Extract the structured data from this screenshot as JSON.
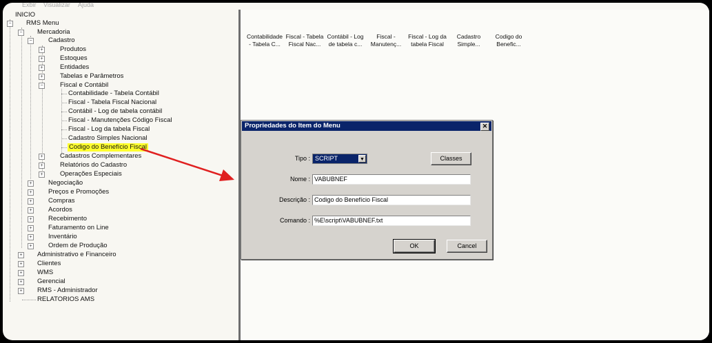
{
  "menubar": {
    "items": [
      "Exbir",
      "Visualizar",
      "Ajuda"
    ]
  },
  "tree": {
    "root": "INICIO",
    "rms_menu": "RMS Menu",
    "mercadorias": "Mercadoria",
    "cadastro": "Cadastro",
    "cadastro_children": [
      "Produtos",
      "Estoques",
      "Entidades",
      "Tabelas e Parâmetros",
      "Fiscal e Contábil"
    ],
    "fiscal_children": [
      "Contabilidade - Tabela Contábil",
      "Fiscal - Tabela Fiscal Nacional",
      "Contábil - Log de tabela contábil",
      "Fiscal - Manutenções Código Fiscal",
      "Fiscal - Log da tabela Fiscal",
      "Cadastro Simples Nacional",
      "Codigo do Benefício Fiscal"
    ],
    "cadastro_siblings": [
      "Cadastros Complementares",
      "Relatórios do Cadastro",
      "Operações Especiais"
    ],
    "mercadorias_children": [
      "Negociação",
      "Preços e Promoções",
      "Compras",
      "Acordos",
      "Recebimento",
      "Faturamento on Line",
      "Inventário",
      "Ordem de Produção"
    ],
    "top_children": [
      "Administrativo e Financeiro",
      "Clientes",
      "WMS",
      "Gerencial",
      "RMS - Administrador"
    ],
    "relatorios": "RELATORIOS AMS"
  },
  "columns": [
    [
      "Contabilidade",
      "- Tabela C..."
    ],
    [
      "Fiscal - Tabela",
      "Fiscal Nac..."
    ],
    [
      "Contábil - Log",
      "de tabela c..."
    ],
    [
      "Fiscal -",
      "Manutenç..."
    ],
    [
      "Fiscal - Log da",
      "tabela Fiscal"
    ],
    [
      "Cadastro",
      "Simple..."
    ],
    [
      "Codigo do",
      "Benefic..."
    ]
  ],
  "dialog": {
    "title": "Propriedades do Item do Menu",
    "close": "✕",
    "tipo_label": "Tipo :",
    "tipo_value": "SCRIPT",
    "classes_button": "Classes",
    "nome_label": "Nome :",
    "nome_value": "VABUBNEF",
    "descricao_label": "Descrição :",
    "descricao_value": "Codigo do Benefício Fiscal",
    "comando_label": "Comando :",
    "comando_value": "%E\\script\\VABUBNEF.txt",
    "ok_button": "OK",
    "cancel_button": "Cancel"
  },
  "colors": {
    "highlight": "#ffff2e",
    "arrow": "#e02020",
    "titlebar": "#0a246a"
  }
}
